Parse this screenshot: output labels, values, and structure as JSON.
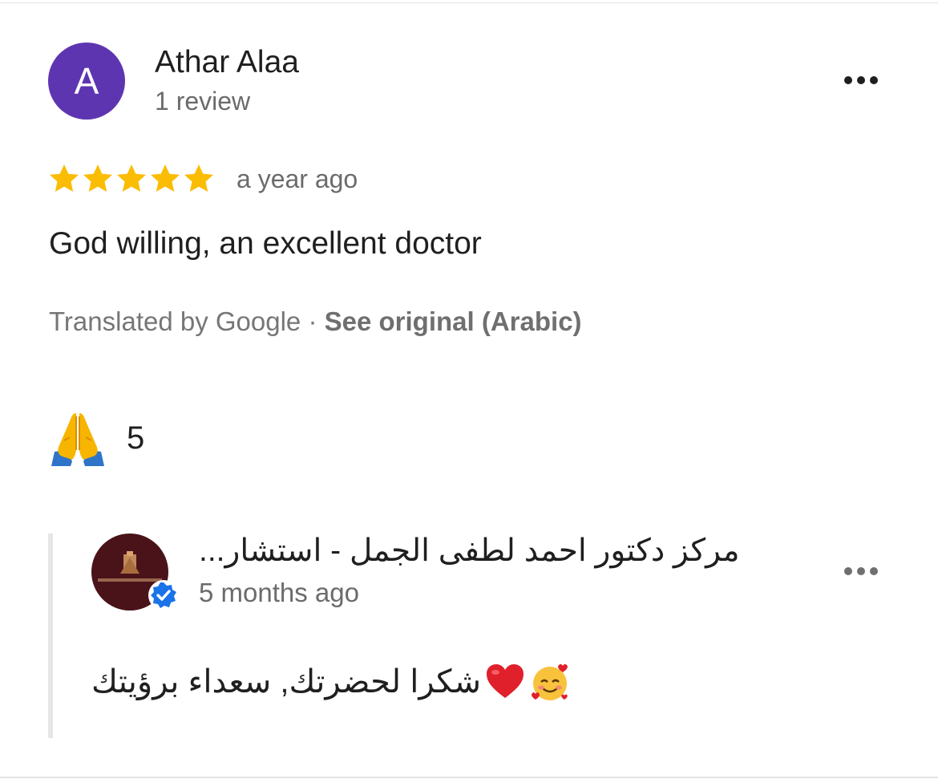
{
  "colors": {
    "avatar_bg": "#5e35b1",
    "star": "#fbbc04",
    "verified": "#1a73e8"
  },
  "review": {
    "author": {
      "initial": "A",
      "name": "Athar Alaa",
      "review_count": "1 review"
    },
    "rating": 5,
    "max_rating": 5,
    "time": "a year ago",
    "text": "God willing, an excellent doctor",
    "translation": {
      "prefix": "Translated by Google · ",
      "link": "See original (Arabic)"
    },
    "reaction": {
      "icon": "folded-hands-icon",
      "count": "5"
    },
    "menu_icon": "more-options-icon"
  },
  "owner_reply": {
    "name": "مركز دكتور احمد لطفى الجمل - استشار...",
    "time": "5 months ago",
    "avatar_icon": "clinic-logo-icon",
    "badge_icon": "verified-icon",
    "text": "شكرا لحضرتك, سعداء برؤيتك",
    "emojis": [
      "smiling-face-with-hearts-icon",
      "red-heart-icon"
    ],
    "menu_icon": "more-options-icon"
  }
}
